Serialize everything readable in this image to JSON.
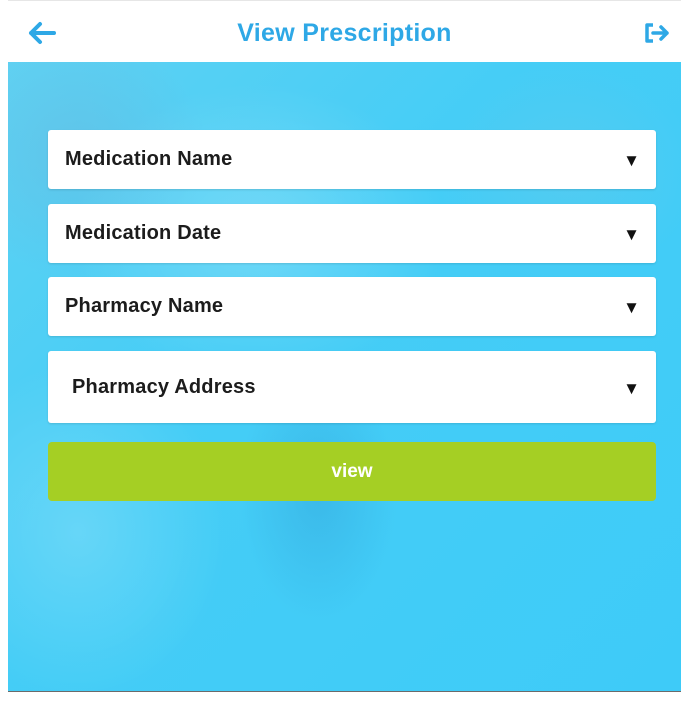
{
  "header": {
    "title": "View Prescription",
    "back_icon": "arrow-left-icon",
    "exit_icon": "logout-icon",
    "accent_color": "#2ea8e6"
  },
  "form": {
    "fields": [
      {
        "label": "Medication Name",
        "icon": "caret-down-icon"
      },
      {
        "label": "Medication Date",
        "icon": "caret-down-icon"
      },
      {
        "label": "Pharmacy Name",
        "icon": "caret-down-icon"
      },
      {
        "label": "Pharmacy Address",
        "icon": "caret-down-icon"
      }
    ],
    "dropdown_arrow": "▼",
    "view_button_label": "view",
    "view_button_color": "#a5cf24"
  },
  "theme": {
    "background_color": "#45cdf6"
  }
}
